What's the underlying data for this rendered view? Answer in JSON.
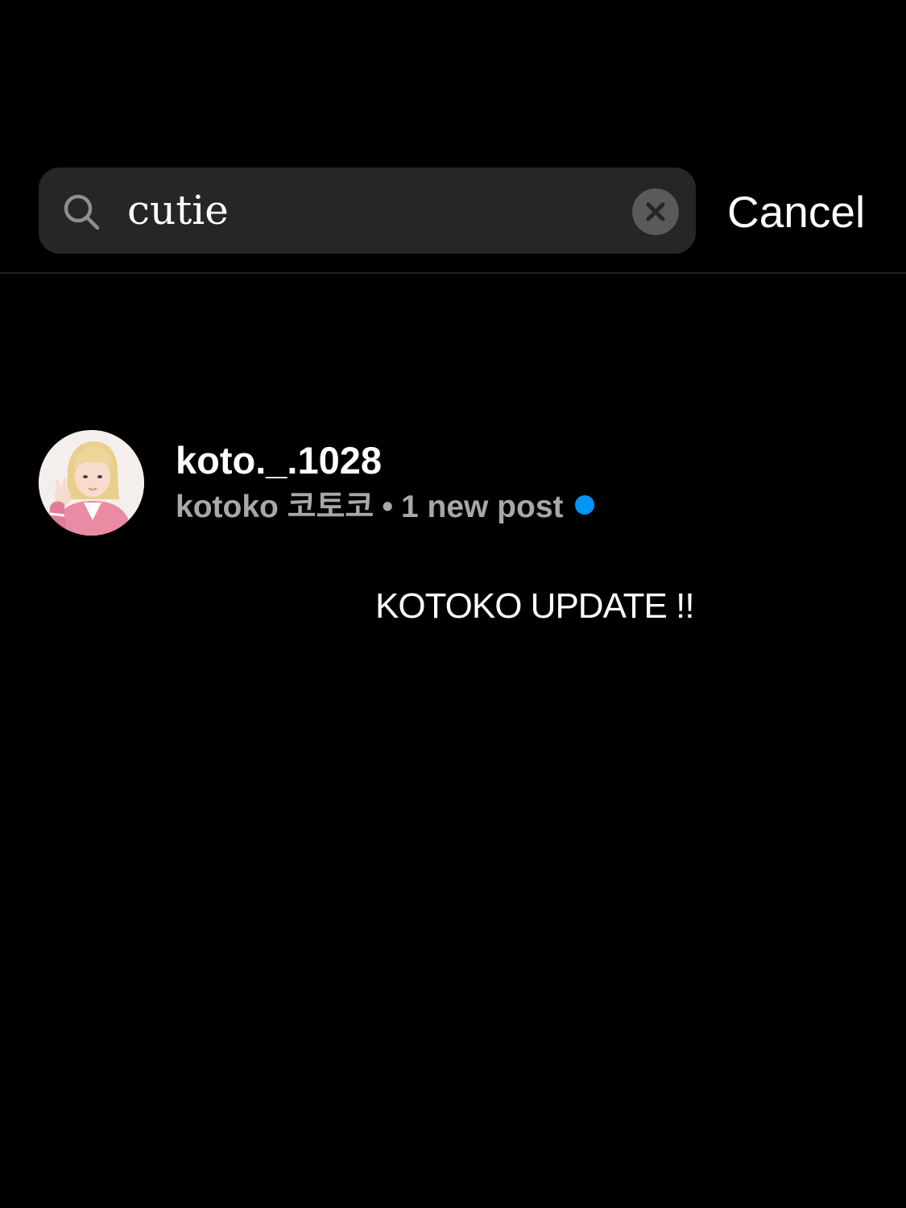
{
  "search": {
    "value": "cutie",
    "clear_icon": "close-icon",
    "search_icon": "search-icon"
  },
  "header": {
    "cancel_label": "Cancel"
  },
  "results": [
    {
      "username": "koto._.1028",
      "display_name": "kotoko 코토코",
      "separator": "•",
      "status": "1 new post",
      "has_new_post_dot": true
    }
  ],
  "overlay": {
    "caption": "KOTOKO UPDATE !!"
  },
  "colors": {
    "background": "#000000",
    "search_bar": "#262626",
    "secondary_text": "#a8a8a8",
    "accent_dot": "#0095f6"
  }
}
